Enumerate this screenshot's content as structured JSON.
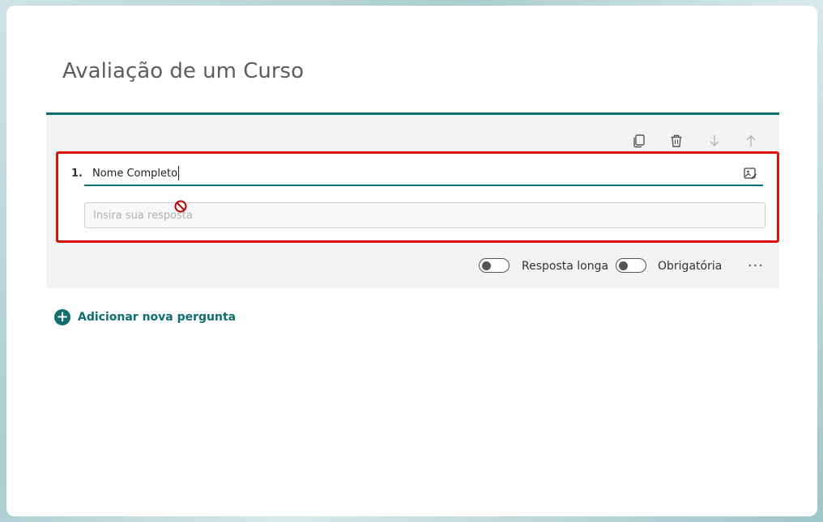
{
  "form": {
    "title": "Avaliação de um Curso"
  },
  "question": {
    "number": "1.",
    "title": "Nome Completo",
    "answer_placeholder": "Insira sua resposta",
    "toolbar": {
      "copy_icon": "copy-icon",
      "delete_icon": "trash-icon",
      "move_down_icon": "arrow-down-icon",
      "move_up_icon": "arrow-up-icon"
    },
    "options": {
      "long_answer_label": "Resposta longa",
      "required_label": "Obrigatória",
      "more_label": "···"
    }
  },
  "add_question": {
    "label": "Adicionar nova pergunta",
    "icon": "+"
  },
  "colors": {
    "accent": "#0f6e6e",
    "highlight": "#e01010",
    "cursor_no_entry": "#c00000"
  }
}
